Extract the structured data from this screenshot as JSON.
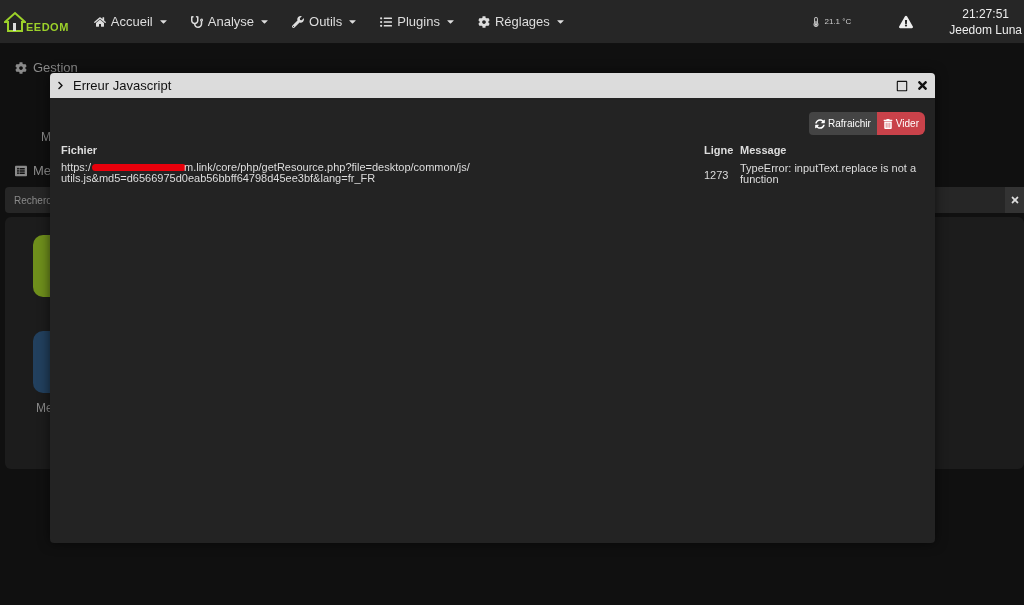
{
  "navbar": {
    "logo": "EEDOM",
    "menus": [
      {
        "label": "Accueil"
      },
      {
        "label": "Analyse"
      },
      {
        "label": "Outils"
      },
      {
        "label": "Plugins"
      },
      {
        "label": "Réglages"
      }
    ],
    "temperature": "21.1 °C",
    "time": "21:27:51",
    "user": "Jeedom Luna"
  },
  "background": {
    "section_title": "Gestion",
    "tile_label": "M",
    "list_title": "Me",
    "search": {
      "placeholder": "Recherc"
    },
    "tiles": [
      {
        "kind": "green"
      },
      {
        "label": "Me",
        "kind": "blue"
      }
    ]
  },
  "modal": {
    "title": "Erreur Javascript",
    "buttons": [
      {
        "label": "Rafraichir",
        "kind": "refresh"
      },
      {
        "label": "Vider",
        "kind": "danger"
      }
    ],
    "columns": [
      "Fichier",
      "Ligne",
      "Message"
    ],
    "rows": [
      {
        "file_start": "https:/",
        "file_rest": "m.link/core/php/getResource.php?file=desktop/common/js/",
        "file_line2": "utils.js&md5=d6566975d0eab56bbff64798d45ee3bf&lang=fr_FR",
        "line": "1273",
        "message": "TypeError: inputText.replace is not a function"
      }
    ]
  }
}
